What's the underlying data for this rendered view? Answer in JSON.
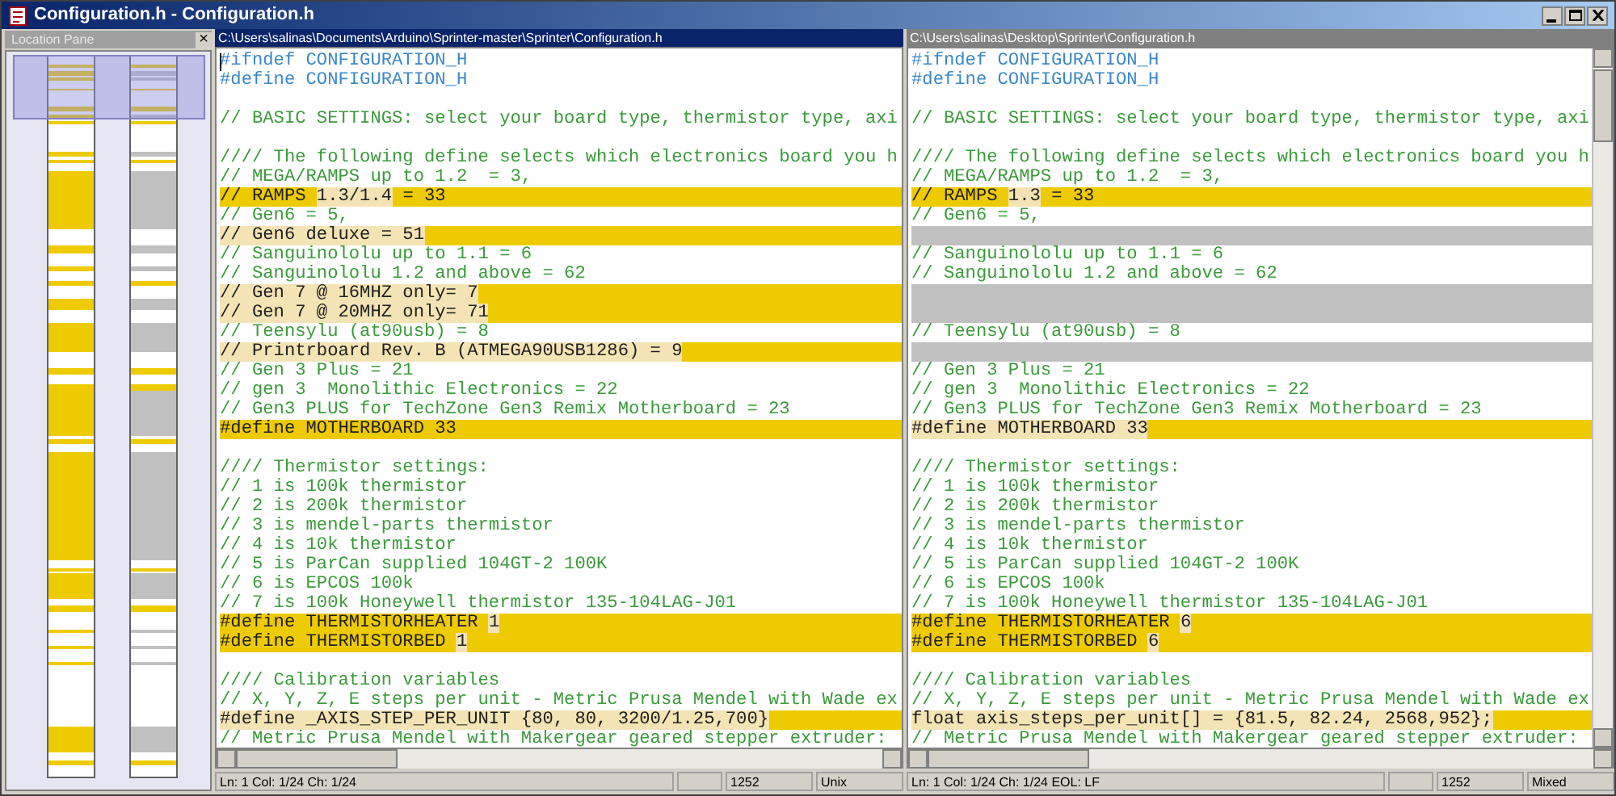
{
  "window": {
    "title": "Configuration.h - Configuration.h"
  },
  "location_pane": {
    "title": "Location Pane",
    "close": "×"
  },
  "panes": [
    {
      "path": "C:\\Users\\salinas\\Documents\\Arduino\\Sprinter-master\\Sprinter\\Configuration.h",
      "active": true,
      "scrollbar": false,
      "lines": [
        {
          "kind": "directive",
          "text": "#ifndef CONFIGURATION_H"
        },
        {
          "kind": "directive",
          "text": "#define CONFIGURATION_H"
        },
        {
          "kind": "blank"
        },
        {
          "kind": "comment",
          "text": "// BASIC SETTINGS: select your board type, thermistor type, axi"
        },
        {
          "kind": "blank"
        },
        {
          "kind": "comment",
          "text": "//// The following define selects which electronics board you h"
        },
        {
          "kind": "comment",
          "text": "// MEGA/RAMPS up to 1.2  = 3,"
        },
        {
          "kind": "changed",
          "parts": [
            {
              "text": "// RAMPS ",
              "diff": false
            },
            {
              "text": "1.3/1.4",
              "diff": true
            },
            {
              "text": " = 33",
              "diff": false
            }
          ]
        },
        {
          "kind": "comment",
          "text": "// Gen6 = 5,"
        },
        {
          "kind": "changed",
          "parts": [
            {
              "text": "// Gen6 deluxe = 51",
              "diff": true
            }
          ]
        },
        {
          "kind": "comment",
          "text": "// Sanguinololu up to 1.1 = 6"
        },
        {
          "kind": "comment",
          "text": "// Sanguinololu 1.2 and above = 62"
        },
        {
          "kind": "changed",
          "parts": [
            {
              "text": "// Gen 7 @ 16MHZ only= 7",
              "diff": true
            }
          ]
        },
        {
          "kind": "changed",
          "parts": [
            {
              "text": "// Gen 7 @ 20MHZ only= 71",
              "diff": true
            }
          ]
        },
        {
          "kind": "comment",
          "text": "// Teensylu (at90usb) = 8"
        },
        {
          "kind": "changed",
          "parts": [
            {
              "text": "// Printrboard Rev. B (ATMEGA90USB1286) = 9",
              "diff": true
            }
          ]
        },
        {
          "kind": "comment",
          "text": "// Gen 3 Plus = 21"
        },
        {
          "kind": "comment",
          "text": "// gen 3  Monolithic Electronics = 22"
        },
        {
          "kind": "comment",
          "text": "// Gen3 PLUS for TechZone Gen3 Remix Motherboard = 23"
        },
        {
          "kind": "changed",
          "parts": [
            {
              "text": "#define MOTHERBOARD 33",
              "diff": false
            }
          ]
        },
        {
          "kind": "blank"
        },
        {
          "kind": "comment",
          "text": "//// Thermistor settings:"
        },
        {
          "kind": "comment",
          "text": "// 1 is 100k thermistor"
        },
        {
          "kind": "comment",
          "text": "// 2 is 200k thermistor"
        },
        {
          "kind": "comment",
          "text": "// 3 is mendel-parts thermistor"
        },
        {
          "kind": "comment",
          "text": "// 4 is 10k thermistor"
        },
        {
          "kind": "comment",
          "text": "// 5 is ParCan supplied 104GT-2 100K"
        },
        {
          "kind": "comment",
          "text": "// 6 is EPCOS 100k"
        },
        {
          "kind": "comment",
          "text": "// 7 is 100k Honeywell thermistor 135-104LAG-J01"
        },
        {
          "kind": "changed",
          "parts": [
            {
              "text": "#define THERMISTORHEATER ",
              "diff": false
            },
            {
              "text": "1",
              "diff": true
            }
          ]
        },
        {
          "kind": "changed",
          "parts": [
            {
              "text": "#define THERMISTORBED ",
              "diff": false
            },
            {
              "text": "1",
              "diff": true
            }
          ]
        },
        {
          "kind": "blank"
        },
        {
          "kind": "comment",
          "text": "//// Calibration variables"
        },
        {
          "kind": "comment",
          "text": "// X, Y, Z, E steps per unit - Metric Prusa Mendel with Wade ex"
        },
        {
          "kind": "changed",
          "parts": [
            {
              "text": "#define _AXIS_STEP_PER_UNIT {80, 80, 3200/1.25,700}",
              "diff": true
            }
          ]
        },
        {
          "kind": "comment",
          "text": "// Metric Prusa Mendel with Makergear geared stepper extruder:"
        }
      ],
      "status": {
        "position": "Ln: 1 Col: 1/24 Ch: 1/24",
        "codepage": "1252",
        "eol": "Unix"
      }
    },
    {
      "path": "C:\\Users\\salinas\\Desktop\\Sprinter\\Configuration.h",
      "active": false,
      "scrollbar": true,
      "lines": [
        {
          "kind": "directive",
          "text": "#ifndef CONFIGURATION_H"
        },
        {
          "kind": "directive",
          "text": "#define CONFIGURATION_H"
        },
        {
          "kind": "blank"
        },
        {
          "kind": "comment",
          "text": "// BASIC SETTINGS: select your board type, thermistor type, axi"
        },
        {
          "kind": "blank"
        },
        {
          "kind": "comment",
          "text": "//// The following define selects which electronics board you h"
        },
        {
          "kind": "comment",
          "text": "// MEGA/RAMPS up to 1.2  = 3,"
        },
        {
          "kind": "changed",
          "parts": [
            {
              "text": "// RAMPS ",
              "diff": false
            },
            {
              "text": "1.3",
              "diff": true
            },
            {
              "text": " = 33",
              "diff": false
            }
          ]
        },
        {
          "kind": "comment",
          "text": "// Gen6 = 5,"
        },
        {
          "kind": "missing"
        },
        {
          "kind": "comment",
          "text": "// Sanguinololu up to 1.1 = 6"
        },
        {
          "kind": "comment",
          "text": "// Sanguinololu 1.2 and above = 62"
        },
        {
          "kind": "missing"
        },
        {
          "kind": "missing"
        },
        {
          "kind": "comment",
          "text": "// Teensylu (at90usb) = 8"
        },
        {
          "kind": "missing"
        },
        {
          "kind": "comment",
          "text": "// Gen 3 Plus = 21"
        },
        {
          "kind": "comment",
          "text": "// gen 3  Monolithic Electronics = 22"
        },
        {
          "kind": "comment",
          "text": "// Gen3 PLUS for TechZone Gen3 Remix Motherboard = 23"
        },
        {
          "kind": "changed",
          "parts": [
            {
              "text": "#define MOTHERBOARD 33",
              "diff": true
            }
          ]
        },
        {
          "kind": "blank"
        },
        {
          "kind": "comment",
          "text": "//// Thermistor settings:"
        },
        {
          "kind": "comment",
          "text": "// 1 is 100k thermistor"
        },
        {
          "kind": "comment",
          "text": "// 2 is 200k thermistor"
        },
        {
          "kind": "comment",
          "text": "// 3 is mendel-parts thermistor"
        },
        {
          "kind": "comment",
          "text": "// 4 is 10k thermistor"
        },
        {
          "kind": "comment",
          "text": "// 5 is ParCan supplied 104GT-2 100K"
        },
        {
          "kind": "comment",
          "text": "// 6 is EPCOS 100k"
        },
        {
          "kind": "comment",
          "text": "// 7 is 100k Honeywell thermistor 135-104LAG-J01"
        },
        {
          "kind": "changed",
          "parts": [
            {
              "text": "#define THERMISTORHEATER ",
              "diff": false
            },
            {
              "text": "6",
              "diff": true
            }
          ]
        },
        {
          "kind": "changed",
          "parts": [
            {
              "text": "#define THERMISTORBED ",
              "diff": false
            },
            {
              "text": "6",
              "diff": true
            }
          ]
        },
        {
          "kind": "blank"
        },
        {
          "kind": "comment",
          "text": "//// Calibration variables"
        },
        {
          "kind": "comment",
          "text": "// X, Y, Z, E steps per unit - Metric Prusa Mendel with Wade ex"
        },
        {
          "kind": "changed",
          "parts": [
            {
              "text": "float axis_steps_per_unit[] = {81.5, 82.24, 2568,952};",
              "diff": true
            }
          ]
        },
        {
          "kind": "comment",
          "text": "// Metric Prusa Mendel with Makergear geared stepper extruder:"
        }
      ],
      "status": {
        "position": "Ln: 1 Col: 1/24 Ch: 1/24 EOL: LF",
        "codepage": "1252",
        "eol": "Mixed"
      }
    }
  ]
}
